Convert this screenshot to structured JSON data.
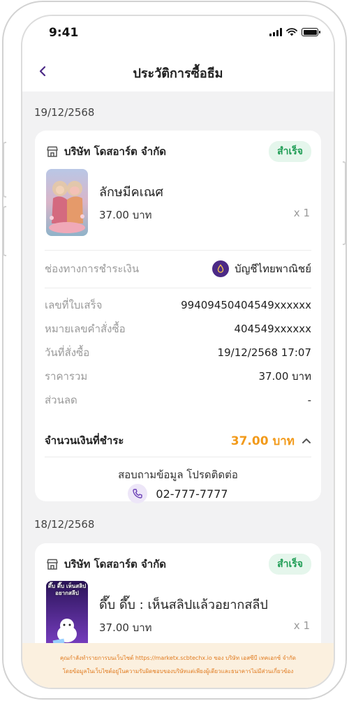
{
  "status_bar": {
    "time": "9:41"
  },
  "header": {
    "title": "ประวัติการซื้อธีม"
  },
  "orders": [
    {
      "date": "19/12/2568",
      "store_name": "บริษัท โดสอาร์ต จำกัด",
      "status": "สำเร็จ",
      "product_name": "ลักษมีคเณศ",
      "product_price": "37.00 บาท",
      "quantity": "x 1",
      "payment_label": "ช่องทางการชำระเงิน",
      "payment_method": "บัญชีไทยพาณิชย์",
      "details": [
        {
          "key": "เลขที่ใบเสร็จ",
          "value": "99409450404549xxxxxx"
        },
        {
          "key": "หมายเลขคำสั่งซื้อ",
          "value": "404549xxxxxx"
        },
        {
          "key": "วันที่สั่งซื้อ",
          "value": "19/12/2568 17:07"
        },
        {
          "key": "ราคารวม",
          "value": "37.00 บาท"
        },
        {
          "key": "ส่วนลด",
          "value": "-"
        }
      ],
      "total_label": "จำนวนเงินที่ชำระ",
      "total_value": "37.00 บาท",
      "contact_text": "สอบถามข้อมูล โปรดติดต่อ",
      "contact_phone": "02-777-7777"
    },
    {
      "date": "18/12/2568",
      "store_name": "บริษัท โดสอาร์ต จำกัด",
      "status": "สำเร็จ",
      "product_name": "ดึ๊บ ดึ๊บ : เห็นสลิปแล้วอยากสลีป",
      "product_price": "37.00 บาท",
      "quantity": "x 1",
      "thumb_text": "ดึ๊บ ดึ๊บ เห็นสลิป อยากสลีป"
    }
  ],
  "footer": {
    "line1": "คุณกำลังทำรายการบนเว็บไซต์ https://marketx.scbtechx.io ของ บริษัท เอสซีบี เทคเอกซ์ จำกัด",
    "line2": "โดยข้อมูลในเว็บไซต์อยู่ในความรับผิดชอบของบริษัทแต่เพียงผู้เดียวและธนาคารไม่มีส่วนเกี่ยวข้อง"
  },
  "colors": {
    "accent_purple": "#4c2a86",
    "success_green": "#1f9d55",
    "total_orange": "#f29a1a",
    "footer_orange": "#e07a1e"
  }
}
